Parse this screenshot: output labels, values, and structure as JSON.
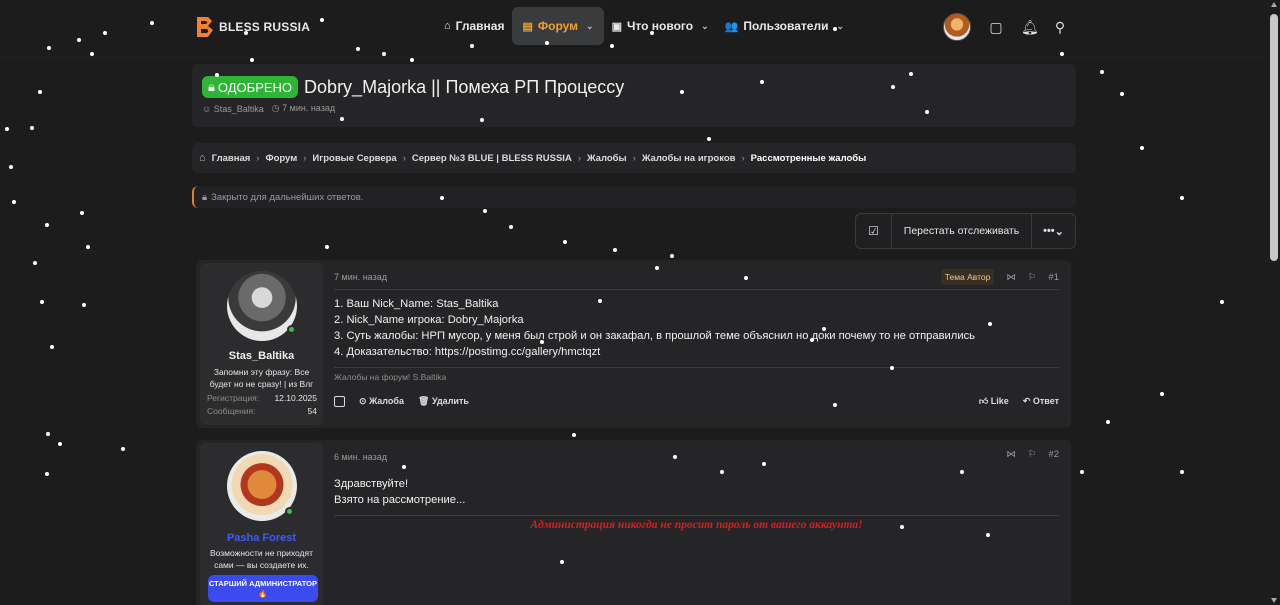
{
  "header": {
    "logo_text": "BLESS RUSSIA",
    "nav": [
      {
        "label": "Главная",
        "icon": "home-icon",
        "active": false,
        "dropdown": false
      },
      {
        "label": "Форум",
        "icon": "forum-icon",
        "active": true,
        "dropdown": true
      },
      {
        "label": "Что нового",
        "icon": "news-icon",
        "active": false,
        "dropdown": true
      },
      {
        "label": "Пользователи",
        "icon": "users-icon",
        "active": false,
        "dropdown": true
      }
    ],
    "right_icons": [
      "avatar",
      "messages-icon",
      "bell-icon",
      "search-icon"
    ]
  },
  "thread": {
    "badge": "ОДОБРЕНО",
    "title": "Dobry_Majorka || Помеха РП Процессу",
    "author": "Stas_Baltika",
    "time": "7 мин. назад"
  },
  "breadcrumb": [
    "Главная",
    "Форум",
    "Игровые Сервера",
    "Сервер №3 BLUE | BLESS RUSSIA",
    "Жалобы",
    "Жалобы на игроков",
    "Рассмотренные жалобы"
  ],
  "closed_notice": "Закрыто для дальнейших ответов.",
  "actions": {
    "unfollow_label": "Перестать отслеживать",
    "more_label": "•••"
  },
  "posts": [
    {
      "username": "Stas_Baltika",
      "user_quote": "Запомни эту фразу: Все будет но не сразу! | из Влг",
      "stats": [
        {
          "k": "Регистрация:",
          "v": "12.10.2025"
        },
        {
          "k": "Сообщения:",
          "v": "54"
        }
      ],
      "time": "7 мин. назад",
      "author_badge": "Тема Автор",
      "number": "#1",
      "lines": [
        "1. Ваш Nick_Name: Stas_Baltika",
        "2. Nick_Name игрока: Dobry_Majorka",
        "3. Суть жалобы: НРП мусор, у меня был строй и он закафал, в прошлой теме объяснил но доки почему то не отправились",
        "4. Доказательство: https://postimg.cc/gallery/hmctqzt"
      ],
      "signature": "Жалобы на форум! S.Baltika",
      "foot": {
        "report": "Жалоба",
        "delete": "Удалить",
        "like": "Like",
        "reply": "Ответ"
      }
    },
    {
      "username": "Pasha Forest",
      "user_quote": "Возможности не приходят сами — вы создаете их.",
      "role": "СТАРШИЙ АДМИНИСТРАТОР 🔥",
      "time": "6 мин. назад",
      "number": "#2",
      "lines": [
        "Здравствуйте!",
        "Взято на рассмотрение..."
      ],
      "admin_note": "Администрация никогда не просит пароль от вашего аккаунта!"
    }
  ],
  "colors": {
    "accent": "#f2a12c",
    "approved": "#2fb536",
    "admin_blue": "#3b5bff",
    "warning_red": "#d81e1e"
  }
}
